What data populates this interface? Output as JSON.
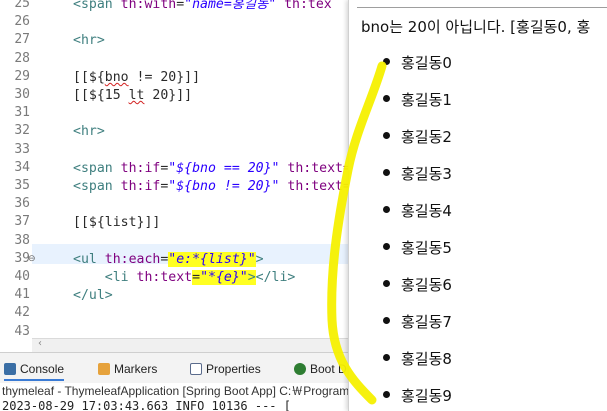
{
  "editor": {
    "lines": [
      {
        "num": "25",
        "segments": [
          {
            "t": "<span ",
            "c": "tag"
          },
          {
            "t": "th:with",
            "c": "attr"
          },
          {
            "t": "=",
            "c": ""
          },
          {
            "t": "\"name=홍길동\"",
            "c": "val"
          },
          {
            "t": " th:tex",
            "c": "attr"
          }
        ]
      },
      {
        "num": "26",
        "segments": []
      },
      {
        "num": "27",
        "segments": [
          {
            "t": "<hr>",
            "c": "tag"
          }
        ]
      },
      {
        "num": "28",
        "segments": []
      },
      {
        "num": "29",
        "segments": [
          {
            "t": "[[${",
            "c": ""
          },
          {
            "t": "bno",
            "c": "squig"
          },
          {
            "t": " != 20}]]",
            "c": ""
          }
        ]
      },
      {
        "num": "30",
        "segments": [
          {
            "t": "[[${15 ",
            "c": ""
          },
          {
            "t": "lt",
            "c": "squig"
          },
          {
            "t": " 20}]]",
            "c": ""
          }
        ]
      },
      {
        "num": "31",
        "segments": []
      },
      {
        "num": "32",
        "segments": [
          {
            "t": "<hr>",
            "c": "tag"
          }
        ]
      },
      {
        "num": "33",
        "segments": []
      },
      {
        "num": "34",
        "segments": [
          {
            "t": "<span ",
            "c": "tag"
          },
          {
            "t": "th:if",
            "c": "attr"
          },
          {
            "t": "=",
            "c": ""
          },
          {
            "t": "\"${bno == 20}\"",
            "c": "val"
          },
          {
            "t": " th:text=",
            "c": "attr"
          }
        ]
      },
      {
        "num": "35",
        "segments": [
          {
            "t": "<span ",
            "c": "tag"
          },
          {
            "t": "th:if",
            "c": "attr"
          },
          {
            "t": "=",
            "c": ""
          },
          {
            "t": "\"${bno != 20}\"",
            "c": "val"
          },
          {
            "t": " th:text=",
            "c": "attr"
          }
        ]
      },
      {
        "num": "36",
        "segments": []
      },
      {
        "num": "37",
        "segments": [
          {
            "t": "[[${list}]]",
            "c": ""
          }
        ]
      },
      {
        "num": "38",
        "segments": []
      },
      {
        "num": "39",
        "segments": [
          {
            "t": "<ul ",
            "c": "tag"
          },
          {
            "t": "th:each",
            "c": "attr"
          },
          {
            "t": "=",
            "c": ""
          },
          {
            "t": "\"e:*{list}\"",
            "c": "val sel"
          },
          {
            "t": ">",
            "c": "tag"
          }
        ]
      },
      {
        "num": "40",
        "segments": [
          {
            "t": "    <li ",
            "c": "tag"
          },
          {
            "t": "th:text",
            "c": "attr"
          },
          {
            "t": "=",
            "c": "sel"
          },
          {
            "t": "\"*{e}\"",
            "c": "val sel"
          },
          {
            "t": ">",
            "c": "tag sel"
          },
          {
            "t": "</li>",
            "c": "tag"
          }
        ]
      },
      {
        "num": "41",
        "segments": [
          {
            "t": "</ul>",
            "c": "tag"
          }
        ]
      },
      {
        "num": "42",
        "segments": []
      },
      {
        "num": "43",
        "segments": []
      }
    ]
  },
  "console": {
    "tabs": [
      {
        "label": "Console",
        "icon": "console-icon",
        "active": true
      },
      {
        "label": "Markers",
        "icon": "markers-icon",
        "active": false
      },
      {
        "label": "Properties",
        "icon": "properties-icon",
        "active": false
      },
      {
        "label": "Boot D",
        "icon": "boot-dashboard-icon",
        "active": false
      }
    ],
    "title": "thymeleaf - ThymeleafApplication [Spring Boot App] C:￦Program",
    "log_line": "2023-08-29 17:03:43.663  INFO 10136 --- [  "
  },
  "browser": {
    "output_text": "bno는 20이 아닙니다. [홍길동0, 홍",
    "list_items": [
      "홍길동0",
      "홍길동1",
      "홍길동2",
      "홍길동3",
      "홍길동4",
      "홍길동5",
      "홍길동6",
      "홍길동7",
      "홍길동8",
      "홍길동9"
    ]
  },
  "colors": {
    "tag": "#3f7f7f",
    "attribute": "#7f007f",
    "string_value": "#2a00ff",
    "selection_highlight": "#ffff22",
    "annotation_marker": "#f5f000"
  }
}
